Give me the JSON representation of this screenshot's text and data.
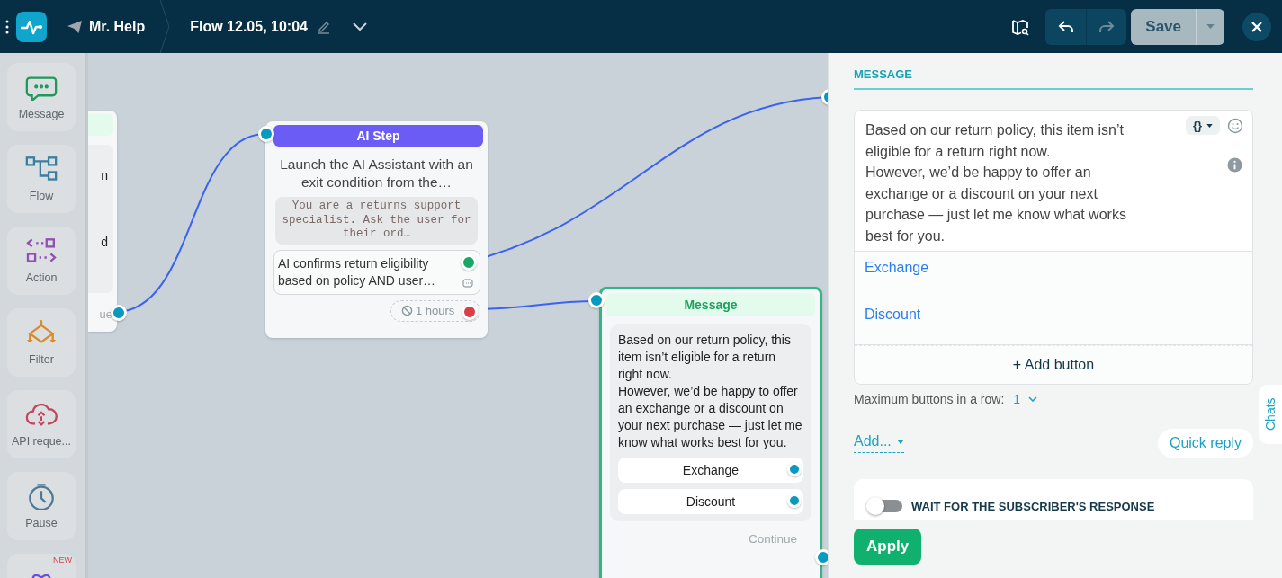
{
  "header": {
    "app_name": "Mr. Help",
    "flow_title": "Flow 12.05, 10:04",
    "save_label": "Save"
  },
  "palette": [
    {
      "kind": "message",
      "label": "Message"
    },
    {
      "kind": "flow",
      "label": "Flow"
    },
    {
      "kind": "action",
      "label": "Action"
    },
    {
      "kind": "filter",
      "label": "Filter"
    },
    {
      "kind": "api",
      "label": "API reque..."
    },
    {
      "kind": "pause",
      "label": "Pause"
    },
    {
      "kind": "ai",
      "badge": "NEW"
    }
  ],
  "canvas": {
    "partial_node": {
      "lines": [
        "n",
        "d"
      ],
      "continue_label": "ue"
    },
    "ai_step": {
      "title": "AI Step",
      "selected": false,
      "description": "Launch the AI Assistant with an exit condition from the…",
      "prompt": "You are a returns support specialist. Ask the user for their ord…",
      "condition": "AI confirms return eligibility based on policy AND user…",
      "timeout": "1 hours"
    },
    "message_node": {
      "title": "Message",
      "selected": true,
      "text": "Based on our return policy, this item isn’t eligible for a return right now.\nHowever, we’d be happy to offer an exchange or a discount on your next purchase — just let me know what works best for you.",
      "buttons": [
        "Exchange",
        "Discount"
      ],
      "continue_label": "Continue"
    }
  },
  "panel": {
    "tab": "MESSAGE",
    "variables_label": "{}",
    "text": "Based on our return policy, this item isn’t eligible for a return right now.\nHowever, we’d be happy to offer an exchange or a discount on your next purchase — just let me know what works best for you.",
    "buttons": [
      "Exchange",
      "Discount"
    ],
    "add_button": "+ Add button",
    "max_label": "Maximum buttons in a row:",
    "max_value": "1",
    "add_menu": "Add...",
    "quick_reply": "Quick reply",
    "wait_label": "WAIT FOR THE SUBSCRIBER'S RESPONSE",
    "wait_on": false,
    "apply": "Apply"
  },
  "chats_tab": "Chats"
}
